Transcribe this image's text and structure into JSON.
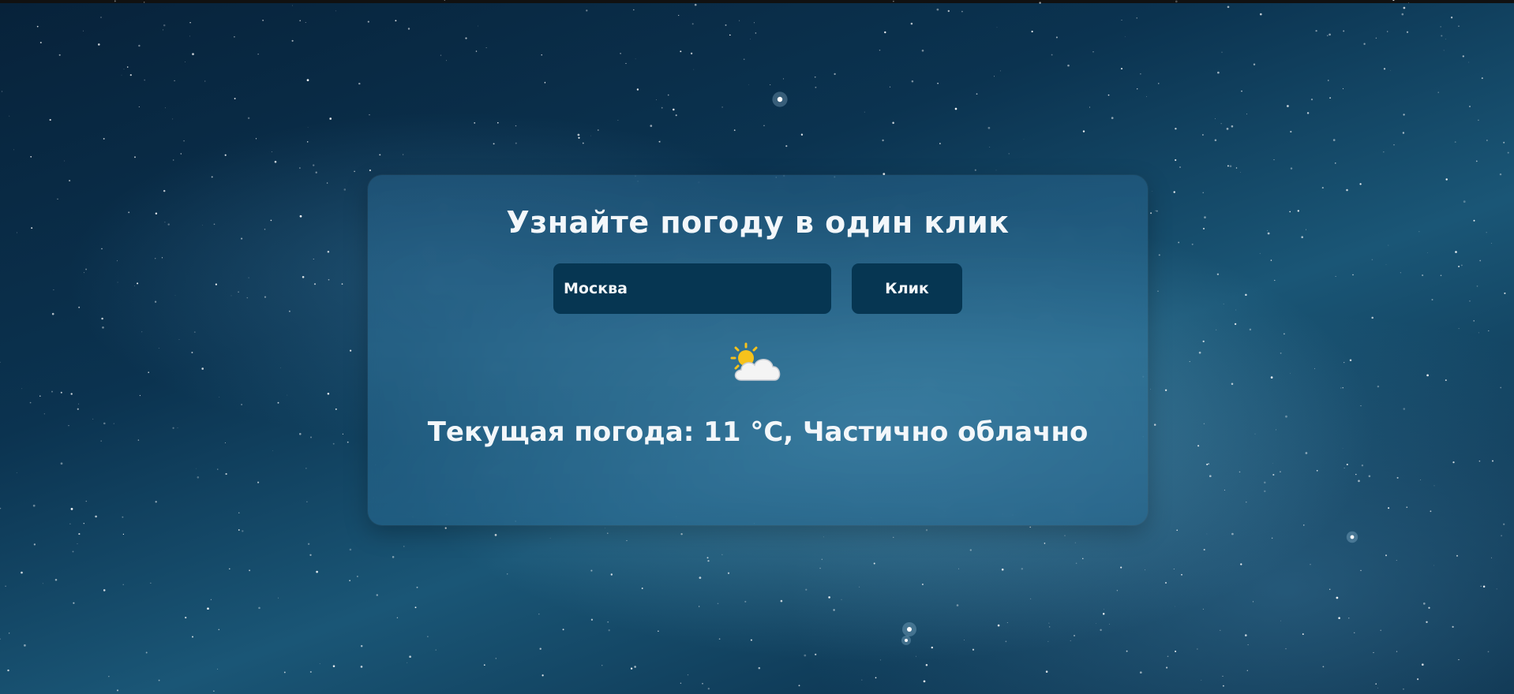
{
  "colors": {
    "background": "#0b3350",
    "card": "#2f7aa3",
    "control": "#063652",
    "text": "#f3f7fa",
    "sun": "#f6c21c",
    "cloud": "#f4f4f4"
  },
  "header": {
    "title": "Узнайте погоду в один клик"
  },
  "search": {
    "value": "Москва",
    "button_label": "Клик"
  },
  "weather": {
    "icon": "sun-behind-cloud-icon",
    "status_text": "Текущая погода: 11 °C, Частично облачно",
    "temperature": "11 °C",
    "condition": "Частично облачно"
  }
}
